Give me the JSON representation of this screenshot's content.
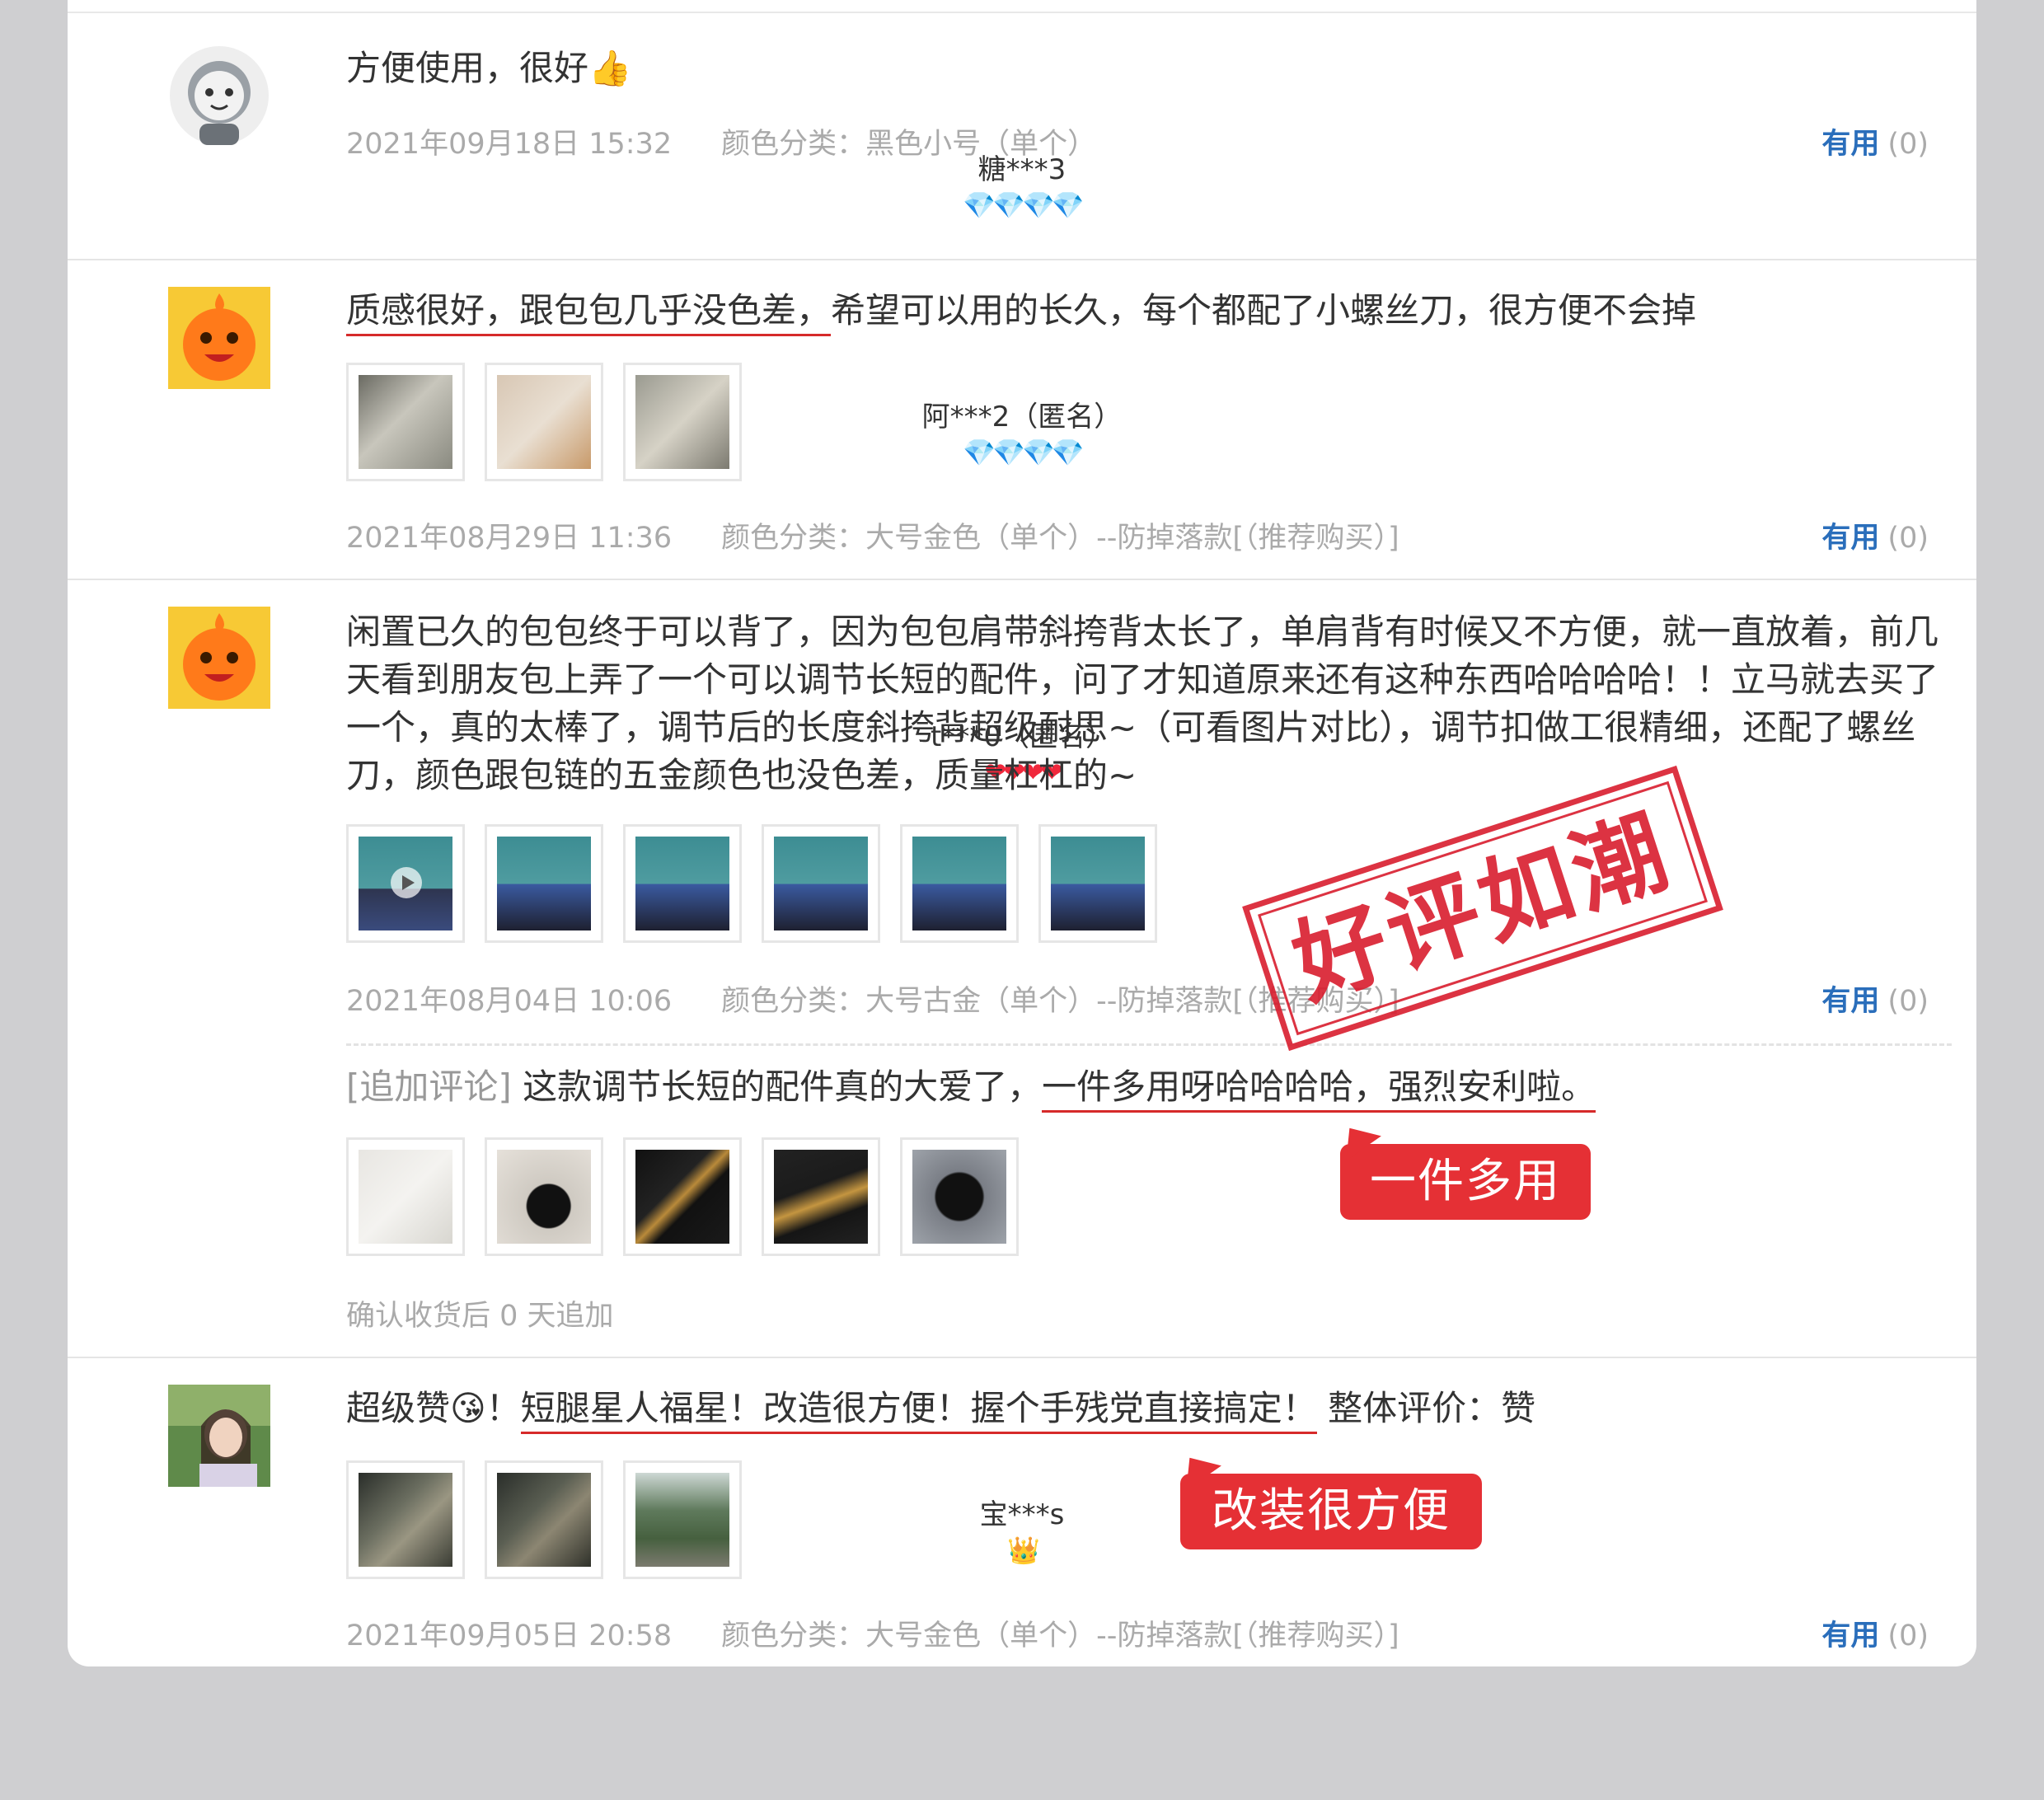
{
  "reviews": [
    {
      "username": "糖***3",
      "level": "💎💎💎💎",
      "text": "方便使用，很好👍",
      "date": "2021年09月18日 15:32",
      "sku": "颜色分类：黑色小号（单个）",
      "useful_label": "有用",
      "useful_count": "(0)"
    },
    {
      "username": "阿***2（匿名）",
      "level": "💎💎💎💎",
      "text_underlined": "质感很好，跟包包几乎没色差，",
      "text_rest": "希望可以用的长久，每个都配了小螺丝刀，很方便不会掉",
      "date": "2021年08月29日 11:36",
      "sku": "颜色分类：大号金色（单个）--防掉落款[（推荐购买）]",
      "useful_label": "有用",
      "useful_count": "(0)"
    },
    {
      "username": "t***0（匿名）",
      "level": "❤❤❤❤",
      "text": "闲置已久的包包终于可以背了，因为包包肩带斜挎背太长了，单肩背有时候又不方便，就一直放着，前几天看到朋友包上弄了一个可以调节长短的配件，问了才知道原来还有这种东西哈哈哈哈！！立马就去买了一个，真的太棒了，调节后的长度斜挎背超级耐思~（可看图片对比），调节扣做工很精细，还配了螺丝刀，颜色跟包链的五金颜色也没色差，质量杠杠的~",
      "date": "2021年08月04日 10:06",
      "sku": "颜色分类：大号古金（单个）--防掉落款[（推荐购买）]",
      "useful_label": "有用",
      "useful_count": "(0)",
      "append_label": "[追加评论]",
      "append_text": "这款调节长短的配件真的大爱了，",
      "append_underlined": "一件多用呀哈哈哈哈，强烈安利啦。",
      "append_note": "确认收货后 0 天追加"
    },
    {
      "username": "宝***s",
      "level": "👑",
      "text_pre": "超级赞😘！",
      "text_underlined": "短腿星人福星！改造很方便！握个手残党直接搞定！",
      "text_post": " 整体评价：赞",
      "date": "2021年09月05日 20:58",
      "sku": "颜色分类：大号金色（单个）--防掉落款[（推荐购买）]",
      "useful_label": "有用",
      "useful_count": "(0)"
    }
  ],
  "stamp": "好评如潮",
  "callouts": {
    "multi_use": "一件多用",
    "easy_mod": "改装很方便"
  },
  "colors": {
    "accent_red": "#e53035",
    "link_blue": "#2a6ebb",
    "diamond_blue": "#3aa3f5"
  }
}
